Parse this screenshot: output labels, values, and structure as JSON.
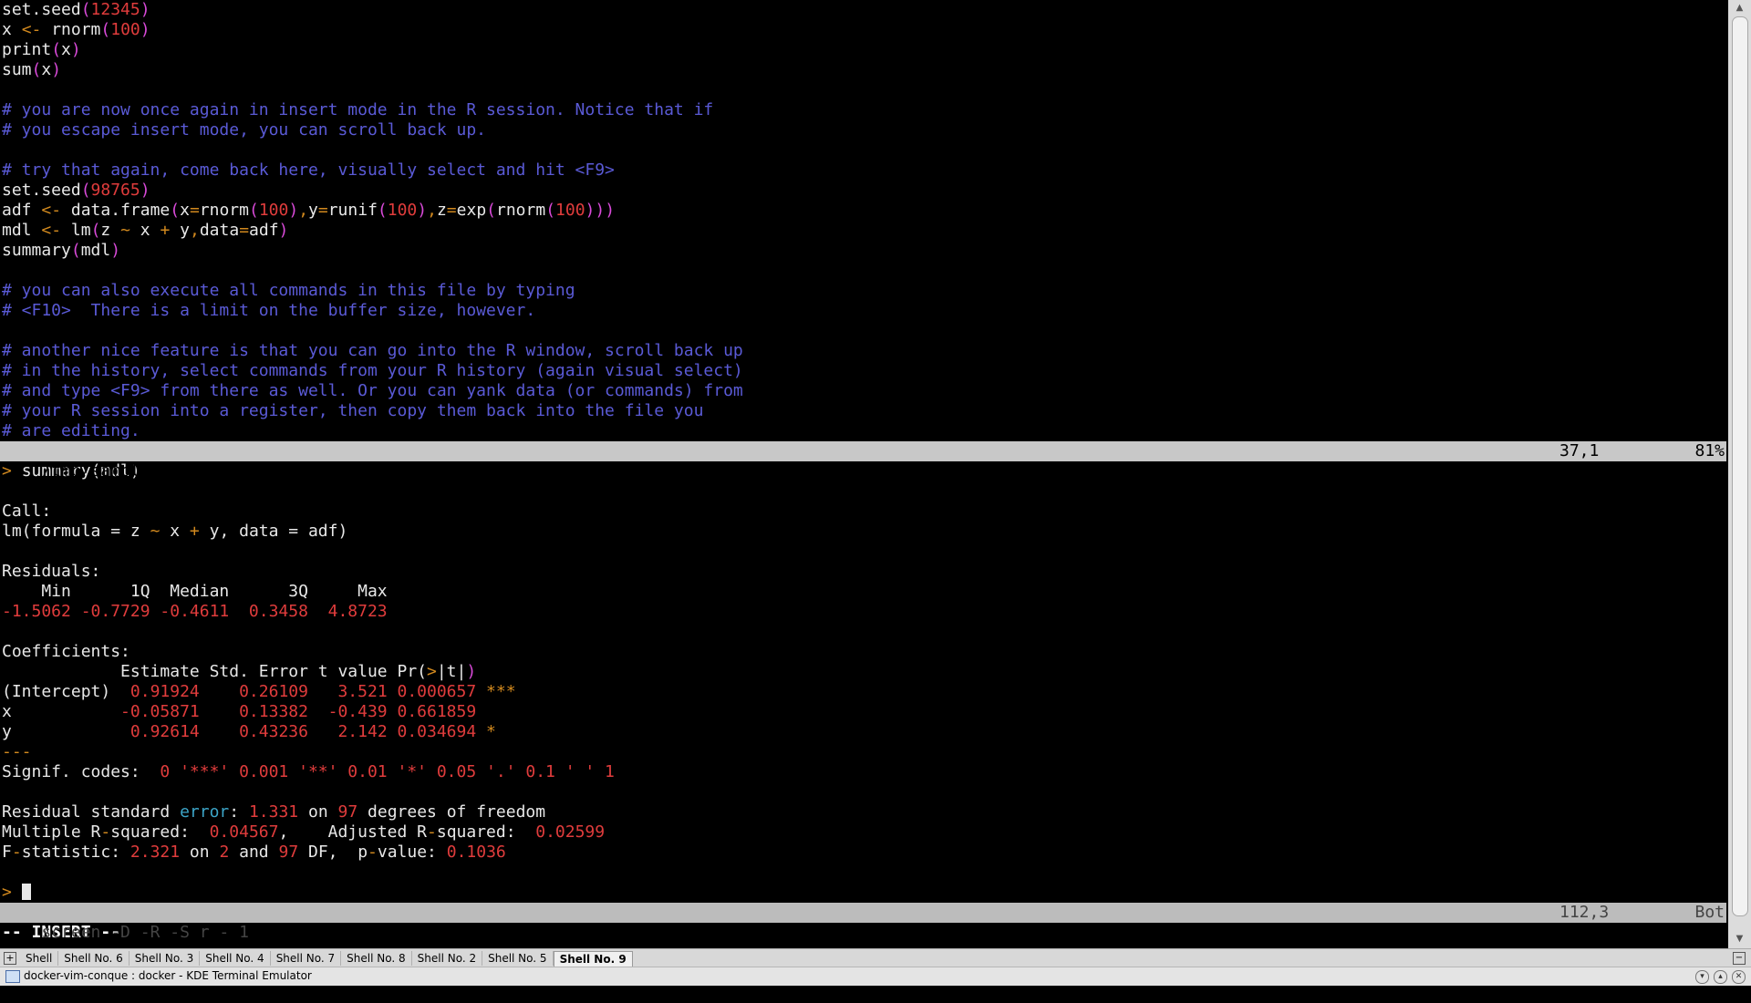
{
  "window": {
    "title": "docker-vim-conque : docker - KDE Terminal Emulator"
  },
  "editor": {
    "file": "/tmp/sample.R",
    "position": "37,1",
    "percent": "81%"
  },
  "r_session": {
    "status": "screen -D -R -S r - 1",
    "position": "112,3",
    "scroll": "Bot",
    "mode": "-- INSERT --"
  },
  "tabs": [
    "Shell",
    "Shell No. 6",
    "Shell No. 3",
    "Shell No. 4",
    "Shell No. 7",
    "Shell No. 8",
    "Shell No. 2",
    "Shell No. 5",
    "Shell No. 9"
  ],
  "active_tab_index": 8,
  "colors": {
    "comment": "#5a5ad6",
    "number": "#e03c3c",
    "operator": "#d2891e",
    "keyword": "#3ca5c8",
    "paren": "#d94ad9",
    "statusbar": "#c8c8c8"
  },
  "icons": [
    "new-tab-icon",
    "close-tab-icon",
    "terminal-app-icon",
    "minimize-icon",
    "maximize-icon",
    "close-window-icon",
    "scroll-up-icon",
    "scroll-down-icon"
  ],
  "editor_lines": [
    [
      [
        "",
        "set.seed"
      ],
      [
        "m",
        "("
      ],
      [
        "n",
        "12345"
      ],
      [
        "m",
        ")"
      ]
    ],
    [
      [
        "",
        "x "
      ],
      [
        "o",
        "<-"
      ],
      [
        "",
        " rnorm"
      ],
      [
        "m",
        "("
      ],
      [
        "n",
        "100"
      ],
      [
        "m",
        ")"
      ]
    ],
    [
      [
        "",
        "print"
      ],
      [
        "m",
        "("
      ],
      [
        "",
        "x"
      ],
      [
        "m",
        ")"
      ]
    ],
    [
      [
        "",
        "sum"
      ],
      [
        "m",
        "("
      ],
      [
        "",
        "x"
      ],
      [
        "m",
        ")"
      ]
    ],
    [],
    [
      [
        "c",
        "# you are now once again in insert mode in the R session. Notice that if"
      ]
    ],
    [
      [
        "c",
        "# you escape insert mode, you can scroll back up."
      ]
    ],
    [],
    [
      [
        "c",
        "# try that again, come back here, visually select and hit <F9>"
      ]
    ],
    [
      [
        "",
        "set.seed"
      ],
      [
        "m",
        "("
      ],
      [
        "n",
        "98765"
      ],
      [
        "m",
        ")"
      ]
    ],
    [
      [
        "",
        "adf "
      ],
      [
        "o",
        "<-"
      ],
      [
        "",
        " data.frame"
      ],
      [
        "m",
        "("
      ],
      [
        "",
        "x"
      ],
      [
        "o",
        "="
      ],
      [
        "",
        "rnorm"
      ],
      [
        "m",
        "("
      ],
      [
        "n",
        "100"
      ],
      [
        "m",
        ")"
      ],
      [
        "o",
        ","
      ],
      [
        "",
        "y"
      ],
      [
        "o",
        "="
      ],
      [
        "",
        "runif"
      ],
      [
        "m",
        "("
      ],
      [
        "n",
        "100"
      ],
      [
        "m",
        ")"
      ],
      [
        "o",
        ","
      ],
      [
        "",
        "z"
      ],
      [
        "o",
        "="
      ],
      [
        "",
        "exp"
      ],
      [
        "m",
        "("
      ],
      [
        "",
        "rnorm"
      ],
      [
        "m",
        "("
      ],
      [
        "n",
        "100"
      ],
      [
        "m",
        ")))"
      ]
    ],
    [
      [
        "",
        "mdl "
      ],
      [
        "o",
        "<-"
      ],
      [
        "",
        " lm"
      ],
      [
        "m",
        "("
      ],
      [
        "",
        "z "
      ],
      [
        "o",
        "~"
      ],
      [
        "",
        " x "
      ],
      [
        "o",
        "+"
      ],
      [
        "",
        " y"
      ],
      [
        "o",
        ","
      ],
      [
        "",
        "data"
      ],
      [
        "o",
        "="
      ],
      [
        "",
        "adf"
      ],
      [
        "m",
        ")"
      ]
    ],
    [
      [
        "",
        "summary"
      ],
      [
        "m",
        "("
      ],
      [
        "",
        "mdl"
      ],
      [
        "m",
        ")"
      ]
    ],
    [],
    [
      [
        "c",
        "# you can also execute all commands in this file by typing"
      ]
    ],
    [
      [
        "c",
        "# <F10>  There is a limit on the buffer size, however."
      ]
    ],
    [],
    [
      [
        "c",
        "# another nice feature is that you can go into the R window, scroll back up"
      ]
    ],
    [
      [
        "c",
        "# in the history, select commands from your R history (again visual select)"
      ]
    ],
    [
      [
        "c",
        "# and type <F9> from there as well. Or you can yank data (or commands) from"
      ]
    ],
    [
      [
        "c",
        "# your R session into a register, then copy them back into the file you"
      ]
    ],
    [
      [
        "c",
        "# are editing."
      ]
    ]
  ],
  "r_lines": [
    [
      [
        "o",
        "> "
      ],
      [
        "",
        "summary(mdl)"
      ]
    ],
    [],
    [
      [
        "",
        "Call:"
      ]
    ],
    [
      [
        "",
        "lm(formula = z "
      ],
      [
        "o",
        "~"
      ],
      [
        "",
        " x "
      ],
      [
        "o",
        "+"
      ],
      [
        "",
        " y, data = adf)"
      ]
    ],
    [],
    [
      [
        "",
        "Residuals:"
      ]
    ],
    [
      [
        "",
        "    Min      1Q  Median      3Q     Max "
      ]
    ],
    [
      [
        "n",
        "-1.5062 -0.7729 -0.4611  0.3458  4.8723 "
      ]
    ],
    [],
    [
      [
        "",
        "Coefficients:"
      ]
    ],
    [
      [
        "",
        "            Estimate Std. Error t value Pr("
      ],
      [
        "o",
        ">"
      ],
      [
        "",
        "|t|"
      ],
      [
        "m",
        ")"
      ],
      [
        "",
        "    "
      ]
    ],
    [
      [
        "",
        "(Intercept)  "
      ],
      [
        "n",
        "0.91924    0.26109   3.521 0.000657 "
      ],
      [
        "o",
        "***"
      ]
    ],
    [
      [
        "",
        "x           "
      ],
      [
        "n",
        "-0.05871    0.13382  -0.439 0.661859    "
      ]
    ],
    [
      [
        "",
        "y            "
      ],
      [
        "n",
        "0.92614    0.43236   2.142 0.034694 "
      ],
      [
        "o",
        "*"
      ]
    ],
    [
      [
        "o",
        "---"
      ]
    ],
    [
      [
        "",
        "Signif. codes:  "
      ],
      [
        "n",
        "0 '***' 0.001 '**' 0.01 '*' 0.05 '.' 0.1 ' ' 1"
      ]
    ],
    [],
    [
      [
        "",
        "Residual standard "
      ],
      [
        "g",
        "error"
      ],
      [
        "",
        ": "
      ],
      [
        "n",
        "1.331"
      ],
      [
        "",
        " on "
      ],
      [
        "n",
        "97"
      ],
      [
        "",
        " degrees of freedom"
      ]
    ],
    [
      [
        "",
        "Multiple R"
      ],
      [
        "o",
        "-"
      ],
      [
        "",
        "squared:  "
      ],
      [
        "n",
        "0.04567"
      ],
      [
        "",
        ",    Adjusted R"
      ],
      [
        "o",
        "-"
      ],
      [
        "",
        "squared:  "
      ],
      [
        "n",
        "0.02599"
      ],
      [
        "",
        ""
      ]
    ],
    [
      [
        "",
        "F"
      ],
      [
        "o",
        "-"
      ],
      [
        "",
        "statistic: "
      ],
      [
        "n",
        "2.321"
      ],
      [
        "",
        " on "
      ],
      [
        "n",
        "2"
      ],
      [
        "",
        " and "
      ],
      [
        "n",
        "97"
      ],
      [
        "",
        " DF,  p"
      ],
      [
        "o",
        "-"
      ],
      [
        "",
        "value: "
      ],
      [
        "n",
        "0.1036"
      ]
    ],
    []
  ]
}
